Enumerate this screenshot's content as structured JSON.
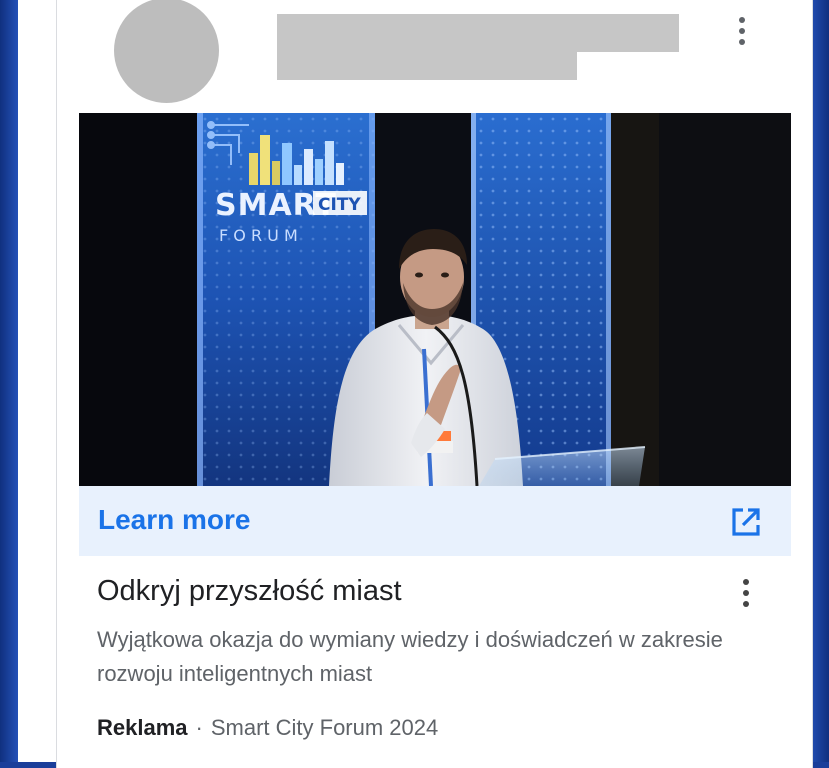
{
  "ad": {
    "image_sign": {
      "brand_main": "SMART",
      "brand_badge": "CITY",
      "brand_sub": "F O R U M"
    },
    "cta_label": "Learn more",
    "cta_icon": "external-link-icon",
    "headline": "Odkryj przyszłość miast",
    "description": "Wyjątkowa okazja do wymiany wiedzy i doświadczeń w zakresie rozwoju inteligentnych miast",
    "ad_label": "Reklama",
    "separator": "·",
    "advertiser": "Smart City Forum 2024"
  },
  "colors": {
    "accent": "#1a73e8",
    "cta_background": "#e8f1fd",
    "placeholder": "#c6c6c6"
  }
}
